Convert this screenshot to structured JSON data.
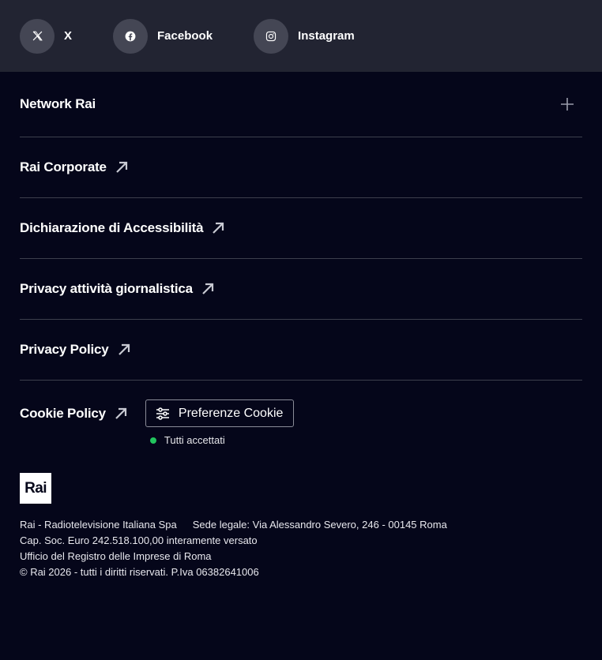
{
  "social": [
    {
      "icon": "x-icon",
      "label": "X"
    },
    {
      "icon": "facebook-icon",
      "label": "Facebook"
    },
    {
      "icon": "instagram-icon",
      "label": "Instagram"
    }
  ],
  "network": {
    "label": "Network Rai",
    "icon": "plus-icon"
  },
  "links": [
    {
      "label": "Rai Corporate",
      "icon": "arrow-up-right-icon"
    },
    {
      "label": "Dichiarazione di Accessibilità",
      "icon": "arrow-up-right-icon"
    },
    {
      "label": "Privacy attività giornalistica",
      "icon": "arrow-up-right-icon"
    },
    {
      "label": "Privacy Policy",
      "icon": "arrow-up-right-icon"
    }
  ],
  "cookie": {
    "label": "Cookie Policy",
    "button_label": "Preferenze Cookie",
    "button_icon": "sliders-icon",
    "status_text": "Tutti accettati",
    "status_color": "#22c55e"
  },
  "logo": {
    "text": "Rai"
  },
  "legal": {
    "company": "Rai - Radiotelevisione Italiana Spa",
    "seat": "Sede legale: Via Alessandro Severo, 246 - 00145 Roma",
    "capital": "Cap. Soc. Euro 242.518.100,00 interamente versato",
    "registry": "Ufficio del Registro delle Imprese di Roma",
    "copyright": "© Rai 2026 - tutti i diritti riservati. P.Iva 06382641006"
  },
  "colors": {
    "background": "#05061a",
    "social_bar": "#222432",
    "divider": "#3d3f4d"
  }
}
